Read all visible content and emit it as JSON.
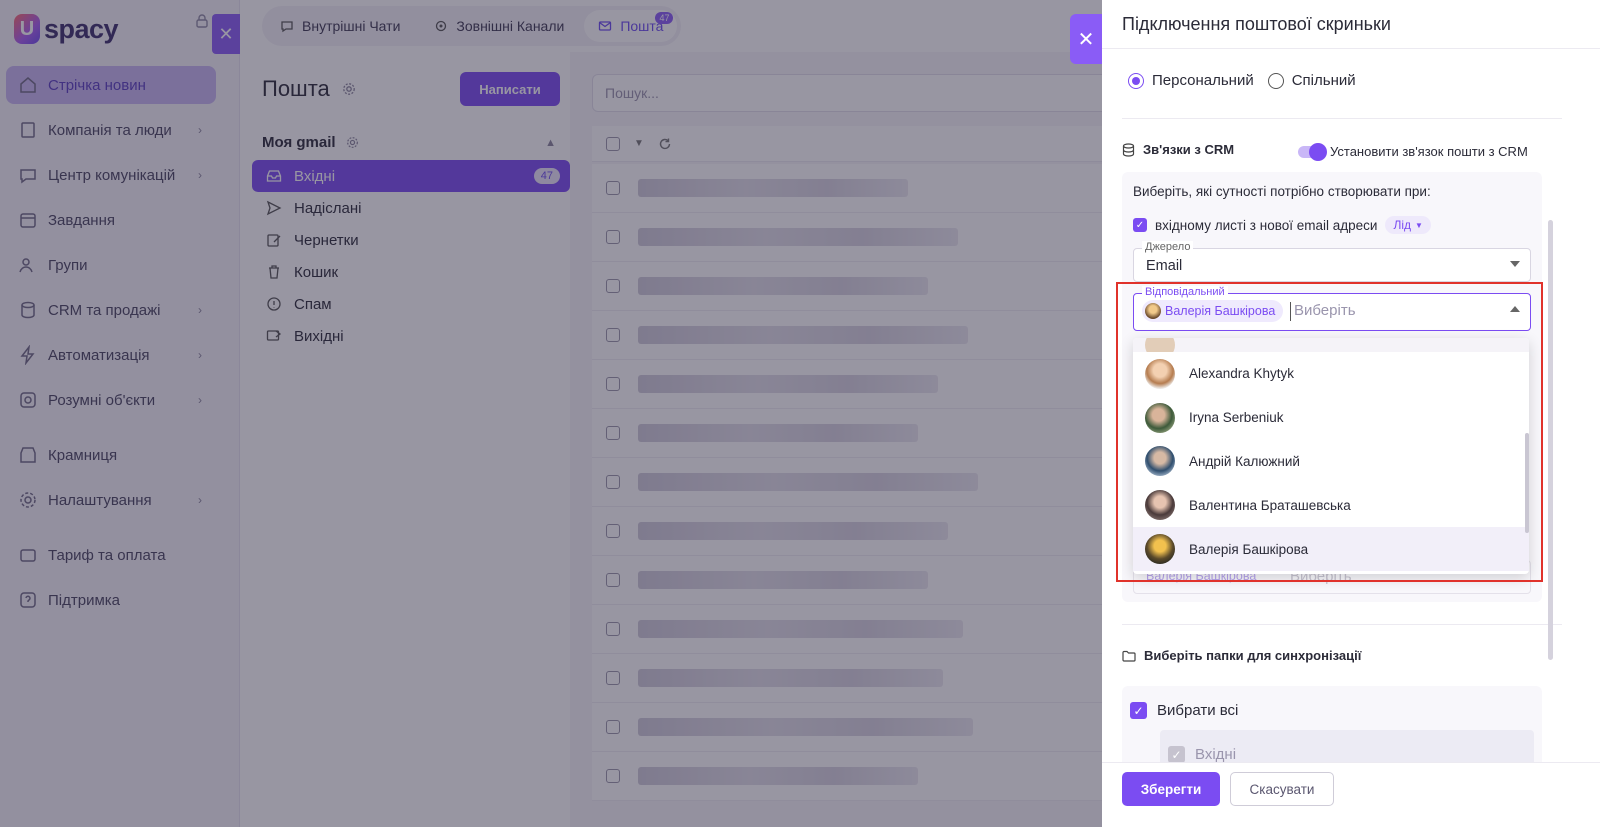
{
  "app": {
    "logo_text": "spacy",
    "logo_mark": "U"
  },
  "sidebar": {
    "close_icon": "✕",
    "items": [
      {
        "label": "Стрічка новин",
        "icon": "home-icon",
        "chevron": false
      },
      {
        "label": "Компанія та люди",
        "icon": "company-icon",
        "chevron": true
      },
      {
        "label": "Центр комунікацій",
        "icon": "chat-icon",
        "chevron": true
      },
      {
        "label": "Завдання",
        "icon": "calendar-icon",
        "chevron": false
      },
      {
        "label": "Групи",
        "icon": "users-icon",
        "chevron": false
      },
      {
        "label": "CRM та продажі",
        "icon": "database-icon",
        "chevron": true
      },
      {
        "label": "Автоматизація",
        "icon": "lightning-icon",
        "chevron": true
      },
      {
        "label": "Розумні об'єкти",
        "icon": "smart-object-icon",
        "chevron": true
      },
      {
        "label": "Крамниця",
        "icon": "store-icon",
        "chevron": false
      },
      {
        "label": "Налаштування",
        "icon": "gear-icon",
        "chevron": true
      },
      {
        "label": "Тариф та оплата",
        "icon": "wallet-icon",
        "chevron": false
      },
      {
        "label": "Підтримка",
        "icon": "help-icon",
        "chevron": false
      }
    ]
  },
  "topbar": {
    "tabs": [
      {
        "label": "Внутрішні Чати",
        "icon": "chat-bubble-icon"
      },
      {
        "label": "Зовнішні Канали",
        "icon": "channels-icon"
      },
      {
        "label": "Пошта",
        "icon": "mail-icon",
        "badge": "47"
      }
    ]
  },
  "mail": {
    "title": "Пошта",
    "write_label": "Написати",
    "account": "Моя gmail",
    "search_placeholder": "Пошук...",
    "folders": [
      {
        "label": "Вхідні",
        "count": "47",
        "icon": "inbox-icon"
      },
      {
        "label": "Надіслані",
        "icon": "send-icon"
      },
      {
        "label": "Чернетки",
        "icon": "edit-icon"
      },
      {
        "label": "Кошик",
        "icon": "trash-icon"
      },
      {
        "label": "Спам",
        "icon": "alert-icon"
      },
      {
        "label": "Вихідні",
        "icon": "outbox-icon"
      }
    ],
    "row_count": 13
  },
  "drawer": {
    "title": "Підключення поштової скриньки",
    "close_icon": "✕",
    "mailbox_type": {
      "options": [
        "Персональний",
        "Спільний"
      ],
      "selected": "Персональний"
    },
    "crm": {
      "heading": "Зв'язки з CRM",
      "toggle_label": "Установити зв'язок пошти з CRM",
      "toggle_on": true,
      "hint": "Виберіть, які сутності потрібно створювати при:",
      "incoming_label": "вхідному листі з нової email адреси",
      "incoming_checked": true,
      "entity": "Лід",
      "source": {
        "label": "Джерело",
        "value": "Email"
      },
      "responsible": {
        "label": "Відповідальний",
        "chip": "Валерія Башкірова",
        "placeholder": "Виберіть",
        "options": [
          "Alexandra Khytyk",
          "Iryna Serbeniuk",
          "Андрій Калюжний",
          "Валентина Браташевська",
          "Валерія Башкірова"
        ],
        "selected": "Валерія Башкірова"
      }
    },
    "sync": {
      "heading": "Виберіть папки для синхронізації",
      "select_all": "Вибрати всі",
      "first_folder": "Вхідні"
    },
    "save_label": "Зберегти",
    "cancel_label": "Скасувати"
  },
  "colors": {
    "accent": "#7b4cf2",
    "highlight": "#e0322b"
  }
}
